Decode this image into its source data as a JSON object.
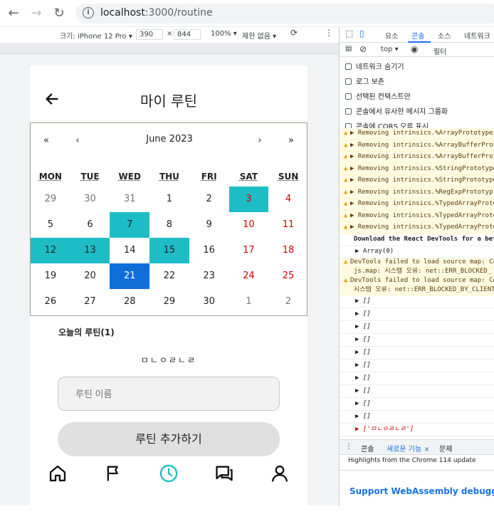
{
  "browser": {
    "url_host": "localhost",
    "url_rest": ":3000/routine"
  },
  "device_toolbar": {
    "dimensions_label": "크기: iPhone 12 Pro ▾",
    "width": "390",
    "times": "×",
    "height": "844",
    "zoom": "100% ▾",
    "throttle": "제한 없음 ▾"
  },
  "app": {
    "title": "마이 루틴",
    "calendar": {
      "month_label": "June 2023",
      "nav": {
        "prev2": "«",
        "prev": "‹",
        "next": "›",
        "next2": "»"
      },
      "weekdays": [
        "MON",
        "TUE",
        "WED",
        "THU",
        "FRI",
        "SAT",
        "SUN"
      ],
      "days": [
        [
          "29",
          "30",
          "31",
          "1",
          "2",
          "3",
          "4"
        ],
        [
          "5",
          "6",
          "7",
          "8",
          "9",
          "10",
          "11"
        ],
        [
          "12",
          "13",
          "14",
          "15",
          "16",
          "17",
          "18"
        ],
        [
          "19",
          "20",
          "21",
          "22",
          "23",
          "24",
          "25"
        ],
        [
          "26",
          "27",
          "28",
          "29",
          "30",
          "1",
          "2"
        ]
      ]
    },
    "today_routines_label": "오늘의 루틴(1)",
    "routine_item": "ㅁㄴㅇㄹㄴㄹ",
    "routine_name_placeholder": "루틴 이름",
    "add_button": "루틴 추가하기",
    "nav_icons": [
      "home-icon",
      "flag-icon",
      "clock-icon",
      "chat-icon",
      "user-icon"
    ],
    "accent_color": "#1ebdc5",
    "today_color": "#0e6fda"
  },
  "devtools": {
    "tabs": [
      "요소",
      "콘솔",
      "소스",
      "네트워크"
    ],
    "context": "top ▾",
    "filter_placeholder": "필터",
    "options": [
      "네트워크 숨기기",
      "로그 보존",
      "선택된 컨텍스트만",
      "콘솔에서 유사한 메시지 그룹화",
      "콘솔에 CORS 오류 표시"
    ],
    "warnings": [
      "▶ Removing intrinsics.%ArrayPrototype",
      "▶ Removing intrinsics.%ArrayBufferProt",
      "▶ Removing intrinsics.%ArrayBufferProt",
      "▶ Removing intrinsics.%StringPrototype",
      "▶ Removing intrinsics.%StringPrototype",
      "▶ Removing intrinsics.%RegExpPrototyp",
      "▶ Removing intrinsics.%TypedArrayProto",
      "▶ Removing intrinsics.%TypedArrayProto",
      "▶ Removing intrinsics.%TypedArrayProto"
    ],
    "info_line": "Download the React DevTools for a bett",
    "array_line": "▶ Array(0)",
    "sourcemap_1a": "DevTools failed to load source map: Co",
    "sourcemap_1b": "js.map: 시스템 오류: net::ERR_BLOCKED_",
    "sourcemap_2a": "DevTools failed to load source map: Co",
    "sourcemap_2b": "시스템 오류: net::ERR_BLOCKED_BY_CLIENT",
    "empty_arrays": [
      "▶ []",
      "▶ []",
      "▶ []",
      "▶ []",
      "▶ []",
      "▶ []",
      "▶ []",
      "▶ []",
      "▶ []",
      "▶ []"
    ],
    "last_array": "▶ ['ㅁㄴㅇㄹㄴㄹ']",
    "prompt": "›",
    "drawer_tabs": [
      "콘솔",
      "새로운 기능 ×",
      "문제"
    ],
    "drawer_note": "Highlights from the Chrome 114 update",
    "drawer_link": "Support WebAssembly debugging"
  }
}
